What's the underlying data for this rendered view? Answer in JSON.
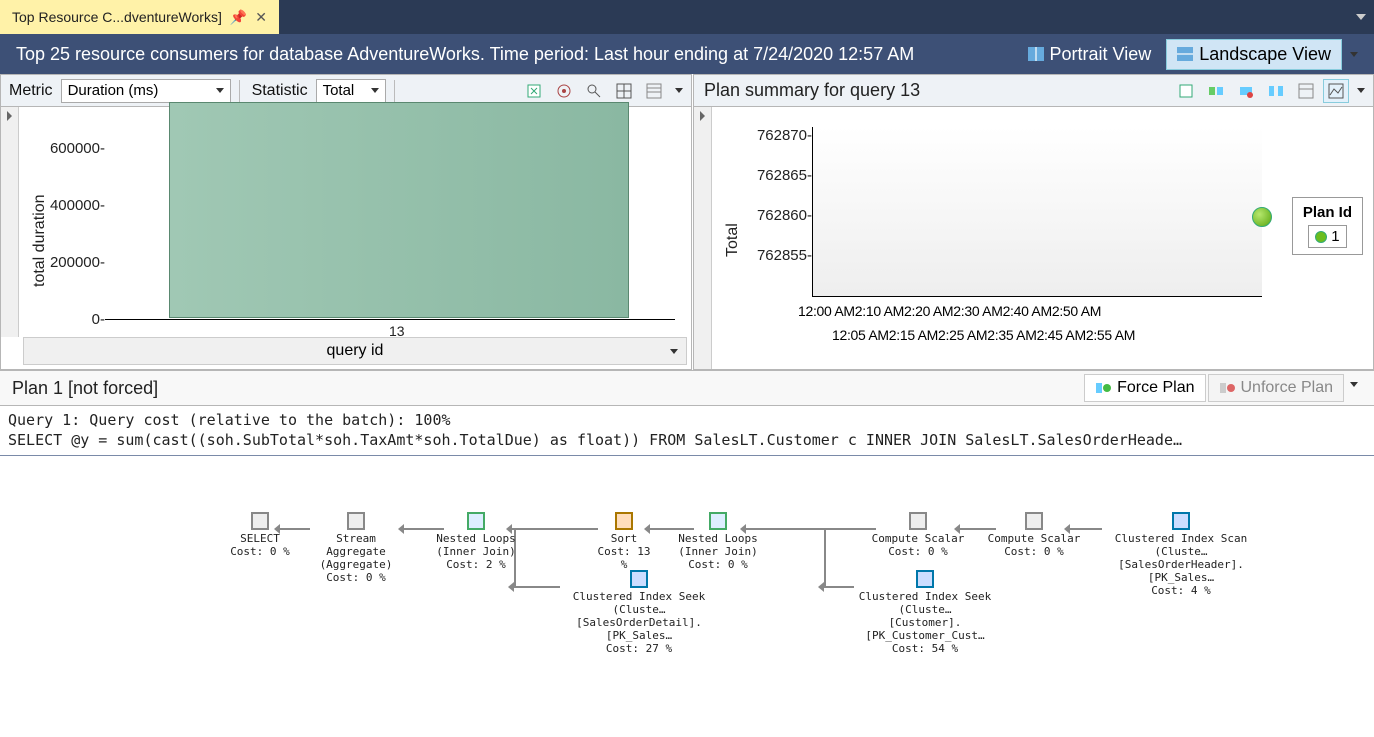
{
  "tab": {
    "title": "Top Resource C...dventureWorks]"
  },
  "header": {
    "title": "Top 25 resource consumers for database AdventureWorks. Time period: Last hour ending at 7/24/2020 12:57 AM",
    "portrait_label": "Portrait View",
    "landscape_label": "Landscape View"
  },
  "left_toolbar": {
    "metric_label": "Metric",
    "metric_value": "Duration (ms)",
    "statistic_label": "Statistic",
    "statistic_value": "Total"
  },
  "right_toolbar": {
    "title": "Plan summary for query 13"
  },
  "plan_section": {
    "title": "Plan 1 [not forced]",
    "force_label": "Force Plan",
    "unforce_label": "Unforce Plan"
  },
  "sql": {
    "line1": "Query 1: Query cost (relative to the batch): 100%",
    "line2": "SELECT @y = sum(cast((soh.SubTotal*soh.TaxAmt*soh.TotalDue) as float)) FROM SalesLT.Customer c INNER JOIN SalesLT.SalesOrderHeade…"
  },
  "chart_data": [
    {
      "id": "left_bar_chart",
      "type": "bar",
      "ylabel": "total duration",
      "xlabel": "query id",
      "ylim": [
        0,
        700000
      ],
      "yticks": [
        0,
        200000,
        400000,
        600000
      ],
      "categories": [
        "13"
      ],
      "values": [
        700000
      ]
    },
    {
      "id": "right_scatter_chart",
      "type": "scatter",
      "ylabel": "Total",
      "legend_title": "Plan Id",
      "ylim": [
        762850,
        762870
      ],
      "yticks": [
        762855,
        762860,
        762865,
        762870
      ],
      "xtick_row1": [
        "12:00 AM",
        "2:10 AM",
        "2:20 AM",
        "2:30 AM",
        "2:40 AM",
        "2:50 AM"
      ],
      "xtick_row2": [
        "12:05 AM",
        "2:15 AM",
        "2:25 AM",
        "2:35 AM",
        "2:45 AM",
        "2:55 AM"
      ],
      "series": [
        {
          "name": "1",
          "points": [
            {
              "x": "2:55 AM",
              "y": 762859
            }
          ]
        }
      ]
    }
  ],
  "exec_plan": {
    "nodes": {
      "select": {
        "l1": "SELECT",
        "l2": "Cost: 0 %"
      },
      "agg": {
        "l1": "Stream Aggregate",
        "l2": "(Aggregate)",
        "l3": "Cost: 0 %"
      },
      "nl1": {
        "l1": "Nested Loops",
        "l2": "(Inner Join)",
        "l3": "Cost: 2 %"
      },
      "sort": {
        "l1": "Sort",
        "l2": "Cost: 13 %"
      },
      "nl2": {
        "l1": "Nested Loops",
        "l2": "(Inner Join)",
        "l3": "Cost: 0 %"
      },
      "cs1": {
        "l1": "Compute Scalar",
        "l2": "Cost: 0 %"
      },
      "cs2": {
        "l1": "Compute Scalar",
        "l2": "Cost: 0 %"
      },
      "scan": {
        "l1": "Clustered Index Scan (Cluste…",
        "l2": "[SalesOrderHeader].[PK_Sales…",
        "l3": "Cost: 4 %"
      },
      "seek1": {
        "l1": "Clustered Index Seek (Cluste…",
        "l2": "[SalesOrderDetail].[PK_Sales…",
        "l3": "Cost: 27 %"
      },
      "seek2": {
        "l1": "Clustered Index Seek (Cluste…",
        "l2": "[Customer].[PK_Customer_Cust…",
        "l3": "Cost: 54 %"
      }
    }
  }
}
